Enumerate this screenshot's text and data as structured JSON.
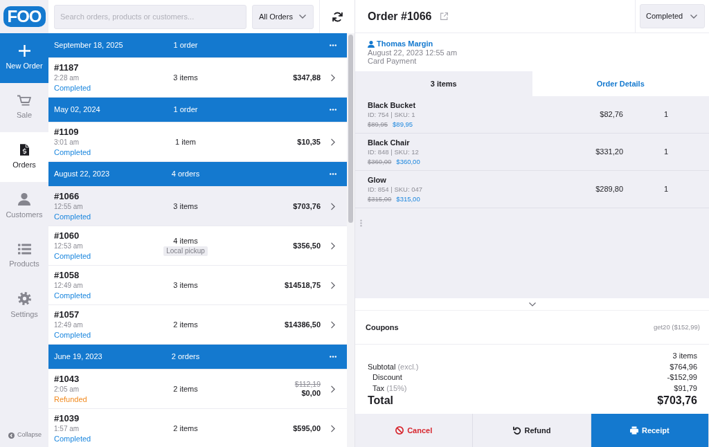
{
  "sidebar": {
    "logo": "FOO",
    "items": [
      {
        "label": "New Order",
        "kind": "action",
        "selected": false
      },
      {
        "label": "Sale",
        "kind": "nav",
        "selected": false
      },
      {
        "label": "Orders",
        "kind": "nav",
        "selected": true
      },
      {
        "label": "Customers",
        "kind": "nav",
        "selected": false
      },
      {
        "label": "Products",
        "kind": "nav",
        "selected": false
      },
      {
        "label": "Settings",
        "kind": "nav",
        "selected": false
      }
    ],
    "collapse": "Collapse"
  },
  "orders_toolbar": {
    "search": {
      "placeholder": "Search orders, products or customers..."
    },
    "filter": {
      "value": "All Orders"
    }
  },
  "order_groups": [
    {
      "date": "September 18, 2025",
      "count": "1 order",
      "orders": [
        {
          "number": "#1187",
          "time": "2:28 am",
          "status": "Completed",
          "color": "#1a86de",
          "items": "3 items",
          "total": "$347,88",
          "selected": false
        }
      ]
    },
    {
      "date": "May 02, 2024",
      "count": "1 order",
      "orders": [
        {
          "number": "#1109",
          "time": "3:01 am",
          "status": "Completed",
          "color": "#1a86de",
          "items": "1 item",
          "total": "$10,35",
          "selected": false
        }
      ]
    },
    {
      "date": "August 22, 2023",
      "count": "4 orders",
      "orders": [
        {
          "number": "#1066",
          "time": "12:55 am",
          "status": "Completed",
          "color": "#1a86de",
          "items": "3 items",
          "total": "$703,76",
          "selected": true
        },
        {
          "number": "#1060",
          "time": "12:53 am",
          "status": "Completed",
          "color": "#1a86de",
          "items": "4 items",
          "tag": "Local pickup",
          "total": "$356,50",
          "selected": false
        },
        {
          "number": "#1058",
          "time": "12:49 am",
          "status": "Completed",
          "color": "#1a86de",
          "items": "3 items",
          "total": "$14518,75",
          "selected": false
        },
        {
          "number": "#1057",
          "time": "12:49 am",
          "status": "Completed",
          "color": "#1a86de",
          "items": "2 items",
          "total": "$14386,50",
          "selected": false
        }
      ]
    },
    {
      "date": "June 19, 2023",
      "count": "2 orders",
      "orders": [
        {
          "number": "#1043",
          "time": "2:05 am",
          "status": "Refunded",
          "color": "#f28a1e",
          "items": "2 items",
          "original_total": "$112,19",
          "total": "$0,00",
          "selected": false
        },
        {
          "number": "#1039",
          "time": "1:57 am",
          "status": "Completed",
          "color": "#1a86de",
          "items": "2 items",
          "total": "$595,00",
          "selected": false
        }
      ]
    }
  ],
  "order_panel": {
    "title": "Order #1066",
    "status_select": {
      "value": "Completed"
    },
    "customer": "Thomas Margin",
    "date": "August 22, 2023 12:55 am",
    "payment": "Card Payment",
    "tabs": [
      {
        "label": "3 items",
        "selected": true
      },
      {
        "label": "Order Details",
        "selected": false
      }
    ],
    "line_items": [
      {
        "name": "Black Bucket",
        "meta": "ID: 754 | SKU: 1",
        "regular_price": "$89,95",
        "price": "$89,95",
        "total": "$82,76",
        "quantity": "1"
      },
      {
        "name": "Black Chair",
        "meta": "ID: 848 | SKU: 12",
        "regular_price": "$360,00",
        "price": "$360,00",
        "total": "$331,20",
        "quantity": "1"
      },
      {
        "name": "Glow",
        "meta": "ID: 854 | SKU: 047",
        "regular_price": "$315,00",
        "price": "$315,00",
        "total": "$289,80",
        "quantity": "1"
      }
    ],
    "coupons": {
      "label": "Coupons",
      "value": "get20 ($152,99)"
    },
    "summary": {
      "count": "3 items",
      "rows": [
        {
          "label": "Subtotal",
          "note": "(excl.)",
          "value": "$764,96",
          "kind": "main"
        },
        {
          "label": "Discount",
          "value": "-$152,99",
          "kind": "adjustment"
        },
        {
          "label": "Tax",
          "note": "(15%)",
          "value": "$91,79",
          "kind": "adjustment"
        }
      ],
      "total": {
        "label": "Total",
        "value": "$703,76"
      }
    },
    "actions": [
      {
        "label": "Cancel",
        "kind": "danger"
      },
      {
        "label": "Refund",
        "kind": "default"
      },
      {
        "label": "Receipt",
        "kind": "primary"
      }
    ]
  }
}
